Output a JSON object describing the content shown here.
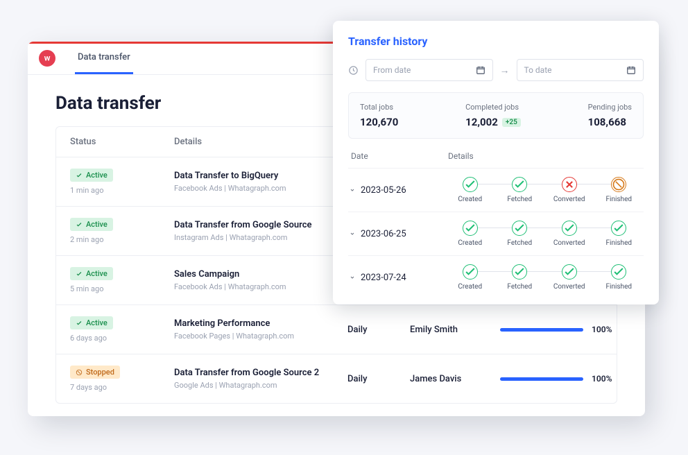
{
  "header": {
    "tab": "Data transfer"
  },
  "page_title": "Data transfer",
  "columns": {
    "status": "Status",
    "details": "Details"
  },
  "rows": [
    {
      "status": "Active",
      "status_kind": "active",
      "ago": "1 min ago",
      "title": "Data Transfer to BigQuery",
      "sub": "Facebook Ads | Whatagraph.com",
      "freq": "",
      "creator": "",
      "pct": ""
    },
    {
      "status": "Active",
      "status_kind": "active",
      "ago": "2 min ago",
      "title": "Data Transfer from Google Source",
      "sub": "Instagram Ads | Whatagraph.com",
      "freq": "",
      "creator": "",
      "pct": ""
    },
    {
      "status": "Active",
      "status_kind": "active",
      "ago": "5 min ago",
      "title": "Sales Campaign",
      "sub": "Facebook Ads | Whatagraph.com",
      "freq": "",
      "creator": "",
      "pct": ""
    },
    {
      "status": "Active",
      "status_kind": "active",
      "ago": "6 days ago",
      "title": "Marketing Performance",
      "sub": "Facebook Pages | Whatagraph.com",
      "freq": "Daily",
      "creator": "Emily Smith",
      "pct": "100%"
    },
    {
      "status": "Stopped",
      "status_kind": "stopped",
      "ago": "7 days ago",
      "title": "Data Transfer from Google Source 2",
      "sub": "Google Ads | Whatagraph.com",
      "freq": "Daily",
      "creator": "James Davis",
      "pct": "100%"
    }
  ],
  "panel": {
    "title": "Transfer history",
    "from_ph": "From date",
    "to_ph": "To date",
    "stats": {
      "total_lbl": "Total jobs",
      "total": "120,670",
      "completed_lbl": "Completed jobs",
      "completed": "12,002",
      "delta": "+25",
      "pending_lbl": "Pending jobs",
      "pending": "108,668"
    },
    "cols": {
      "date": "Date",
      "details": "Details"
    },
    "step_labels": [
      "Created",
      "Fetched",
      "Converted",
      "Finished"
    ],
    "history": [
      {
        "date": "2023-05-26",
        "states": [
          "ok",
          "ok",
          "err",
          "pend"
        ]
      },
      {
        "date": "2023-06-25",
        "states": [
          "ok",
          "ok",
          "ok",
          "ok"
        ]
      },
      {
        "date": "2023-07-24",
        "states": [
          "ok",
          "ok",
          "ok",
          "ok"
        ]
      }
    ]
  }
}
